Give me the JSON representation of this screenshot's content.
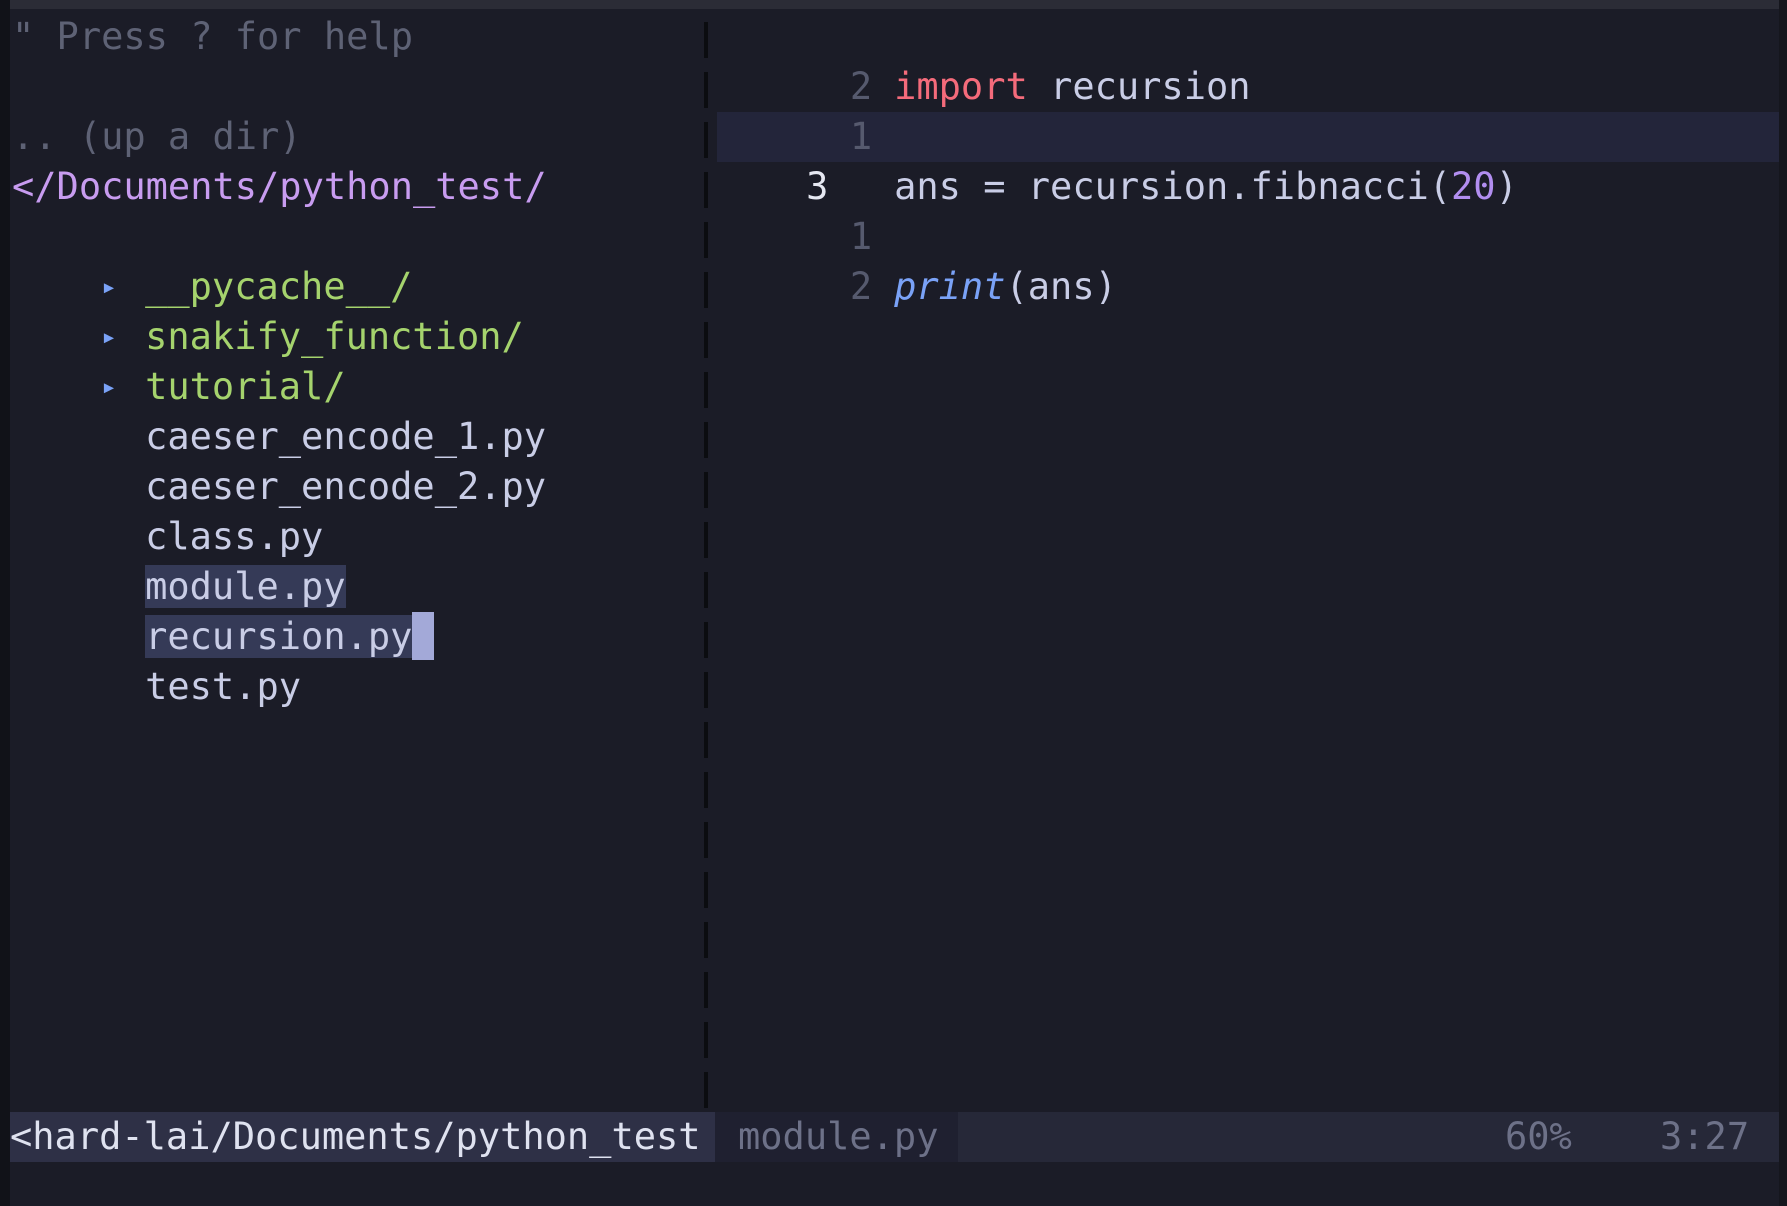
{
  "tree": {
    "help": "\" Press ? for help",
    "up_dir": ".. (up a dir)",
    "cwd": "</Documents/python_test/",
    "dirs": [
      {
        "label": "__pycache__/"
      },
      {
        "label": "snakify_function/"
      },
      {
        "label": "tutorial/"
      }
    ],
    "files": [
      {
        "label": "caeser_encode_1.py"
      },
      {
        "label": "caeser_encode_2.py"
      },
      {
        "label": "class.py"
      },
      {
        "label": "module.py",
        "highlighted": true
      },
      {
        "label": "recursion.py",
        "highlighted": true,
        "cursor": true
      },
      {
        "label": "test.py"
      }
    ],
    "arrow_glyph": "▸",
    "colors": {
      "dir": "#a5d36d",
      "cwd": "#c89cf0",
      "highlight": "#353a57"
    }
  },
  "editor": {
    "lines": [
      {
        "num": "2",
        "tokens": [
          {
            "t": "import",
            "c": "kw"
          },
          {
            "t": " recursion",
            "c": "plain"
          }
        ]
      },
      {
        "num": "1",
        "tokens": []
      },
      {
        "num": "3",
        "current": true,
        "tokens": [
          {
            "t": "ans = recursion.fibnacci(",
            "c": "plain"
          },
          {
            "t": "20",
            "c": "num"
          },
          {
            "t": ")",
            "c": "plain"
          }
        ]
      },
      {
        "num": "1",
        "tokens": []
      },
      {
        "num": "2",
        "tokens": [
          {
            "t": "print",
            "c": "fn"
          },
          {
            "t": "(ans)",
            "c": "plain"
          }
        ]
      }
    ],
    "colors": {
      "keyword": "#f46b7b",
      "number": "#b28ef0",
      "builtin": "#7aa2f7"
    }
  },
  "statusline": {
    "tree_path": "<hard-lai/Documents/python_test",
    "filename": "module.py",
    "percent": "60%",
    "position": "3:27"
  }
}
